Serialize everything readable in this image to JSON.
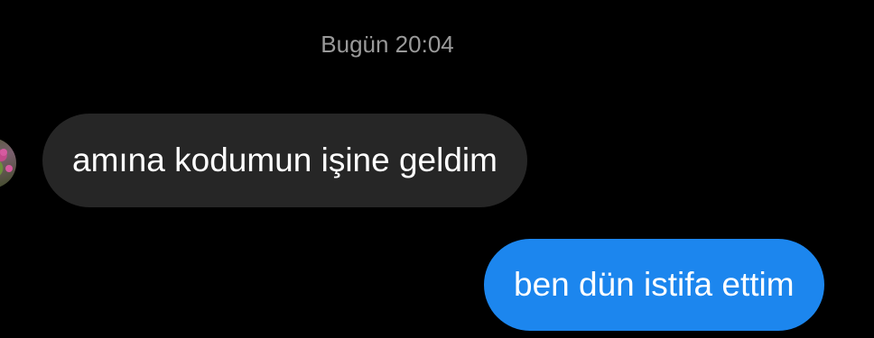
{
  "conversation": {
    "timestamp": "Bugün 20:04",
    "messages": [
      {
        "direction": "incoming",
        "text": "amına kodumun işine geldim"
      },
      {
        "direction": "outgoing",
        "text": "ben dün istifa ettim"
      }
    ]
  },
  "colors": {
    "background": "#000000",
    "incoming_bubble": "#262626",
    "outgoing_bubble": "#1c86ee",
    "timestamp_text": "#9a9a9a",
    "message_text": "#ffffff"
  }
}
